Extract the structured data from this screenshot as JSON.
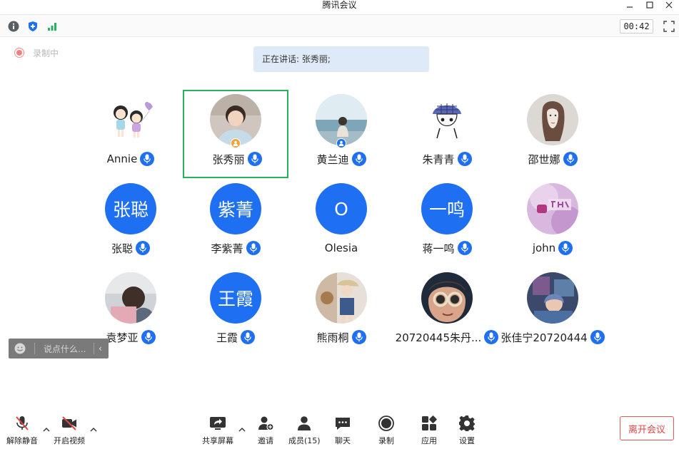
{
  "window": {
    "title": "腾讯会议",
    "minimize_icon": "minimize-icon",
    "maximize_icon": "maximize-icon",
    "close_icon": "close-icon"
  },
  "status_bar": {
    "icons": [
      "info-icon",
      "shield-icon",
      "signal-icon"
    ],
    "timer": "00:42",
    "fullscreen_icon": "fullscreen-icon"
  },
  "recording": {
    "label": "录制中",
    "color": "#f27f7f"
  },
  "speaking_banner": {
    "text": "正在讲话: 张秀丽;"
  },
  "colors": {
    "accent": "#1e6ff1",
    "active_speaker_border": "#27b35c",
    "host_badge": "#f3a23a",
    "leave": "#e24444"
  },
  "participants": [
    {
      "name": "Annie",
      "avatar": "cartoon-girls-avatar",
      "mic": "mic-icon"
    },
    {
      "name": "张秀丽",
      "avatar": "photo-avatar",
      "mic": "mic-icon",
      "speaking": true,
      "role": "host"
    },
    {
      "name": "黄兰迪",
      "avatar": "photo-avatar",
      "mic": "mic-icon",
      "role": "co-host"
    },
    {
      "name": "朱青青",
      "avatar": "cartoon-avatar",
      "mic": "mic-icon"
    },
    {
      "name": "邵世娜",
      "avatar": "sketch-avatar",
      "mic": "mic-icon"
    },
    {
      "name": "张聪",
      "avatar_text": "张聪",
      "mic": "mic-icon"
    },
    {
      "name": "李紫菁",
      "avatar_text": "紫菁",
      "mic": "mic-icon"
    },
    {
      "name": "Olesia",
      "avatar_text": "O",
      "mic": "none"
    },
    {
      "name": "蒋一鸣",
      "avatar_text": "一鸣",
      "mic": "mic-icon"
    },
    {
      "name": "john",
      "avatar": "photo-avatar",
      "mic": "mic-icon"
    },
    {
      "name": "袁梦亚",
      "avatar": "photo-avatar",
      "mic": "mic-icon"
    },
    {
      "name": "王霞",
      "avatar_text": "王霞",
      "mic": "mic-icon"
    },
    {
      "name": "熊雨桐",
      "avatar": "photo-avatar",
      "mic": "mic-icon"
    },
    {
      "name": "20720445朱丹...",
      "avatar": "photo-avatar",
      "mic": "mic-icon"
    },
    {
      "name": "张佳宁20720444",
      "avatar": "photo-avatar",
      "mic": "mic-icon"
    }
  ],
  "chat": {
    "placeholder": "说点什么...",
    "collapse_icon": "chevron-left-icon"
  },
  "toolbar": {
    "unmute": "解除静音",
    "start_video": "开启视频",
    "share_screen": "共享屏幕",
    "invite": "邀请",
    "members": "成员(15)",
    "chat": "聊天",
    "record": "录制",
    "apps": "应用",
    "settings": "设置",
    "leave": "离开会议"
  }
}
